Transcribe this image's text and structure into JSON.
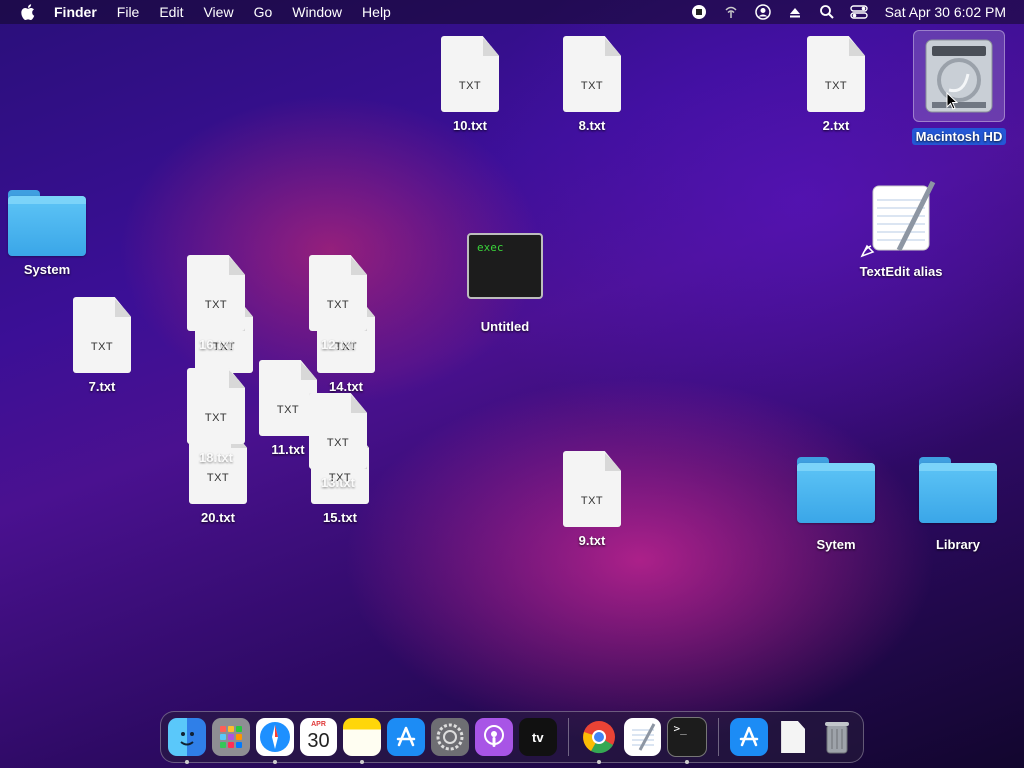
{
  "menubar": {
    "app_name": "Finder",
    "menus": [
      "File",
      "Edit",
      "View",
      "Go",
      "Window",
      "Help"
    ],
    "clock": "Sat Apr 30  6:02 PM",
    "status_icons": [
      "screen-record-stop-icon",
      "wifi-icon",
      "user-account-icon",
      "eject-icon",
      "search-icon",
      "control-center-icon"
    ]
  },
  "desktop": {
    "items": {
      "file_10": {
        "name": "10.txt",
        "ext": "TXT"
      },
      "file_8": {
        "name": "8.txt",
        "ext": "TXT"
      },
      "file_2": {
        "name": "2.txt",
        "ext": "TXT"
      },
      "macintosh_hd": {
        "name": "Macintosh HD",
        "selected": true
      },
      "system": {
        "name": "System"
      },
      "textedit_alias": {
        "name": "TextEdit alias"
      },
      "untitled": {
        "name": "Untitled",
        "preview_text": "exec"
      },
      "file_7": {
        "name": "7.txt",
        "ext": "TXT"
      },
      "file_16": {
        "name": "16.txt",
        "ext": "TXT"
      },
      "file_12": {
        "name": "12.txt",
        "ext": "TXT"
      },
      "file_14": {
        "name": "14.txt",
        "ext": "TXT"
      },
      "file_11": {
        "name": "11.txt",
        "ext": "TXT"
      },
      "file_18": {
        "name": "18.txt",
        "ext": "TXT"
      },
      "file_20": {
        "name": "20.txt",
        "ext": "TXT"
      },
      "file_13": {
        "name": "13.txt",
        "ext": "TXT"
      },
      "file_15": {
        "name": "15.txt",
        "ext": "TXT"
      },
      "file_9": {
        "name": "9.txt",
        "ext": "TXT"
      },
      "sytem": {
        "name": "Sytem"
      },
      "library": {
        "name": "Library"
      }
    }
  },
  "dock": {
    "items": [
      "Finder",
      "Launchpad",
      "Safari",
      "Calendar",
      "Notes",
      "App Store",
      "System Preferences",
      "Podcasts",
      "Apple TV",
      "Google Chrome",
      "TextEdit",
      "Terminal",
      "Applications",
      "Document",
      "Trash"
    ],
    "calendar_month": "APR",
    "calendar_day": "30",
    "tv_label": "tv"
  }
}
